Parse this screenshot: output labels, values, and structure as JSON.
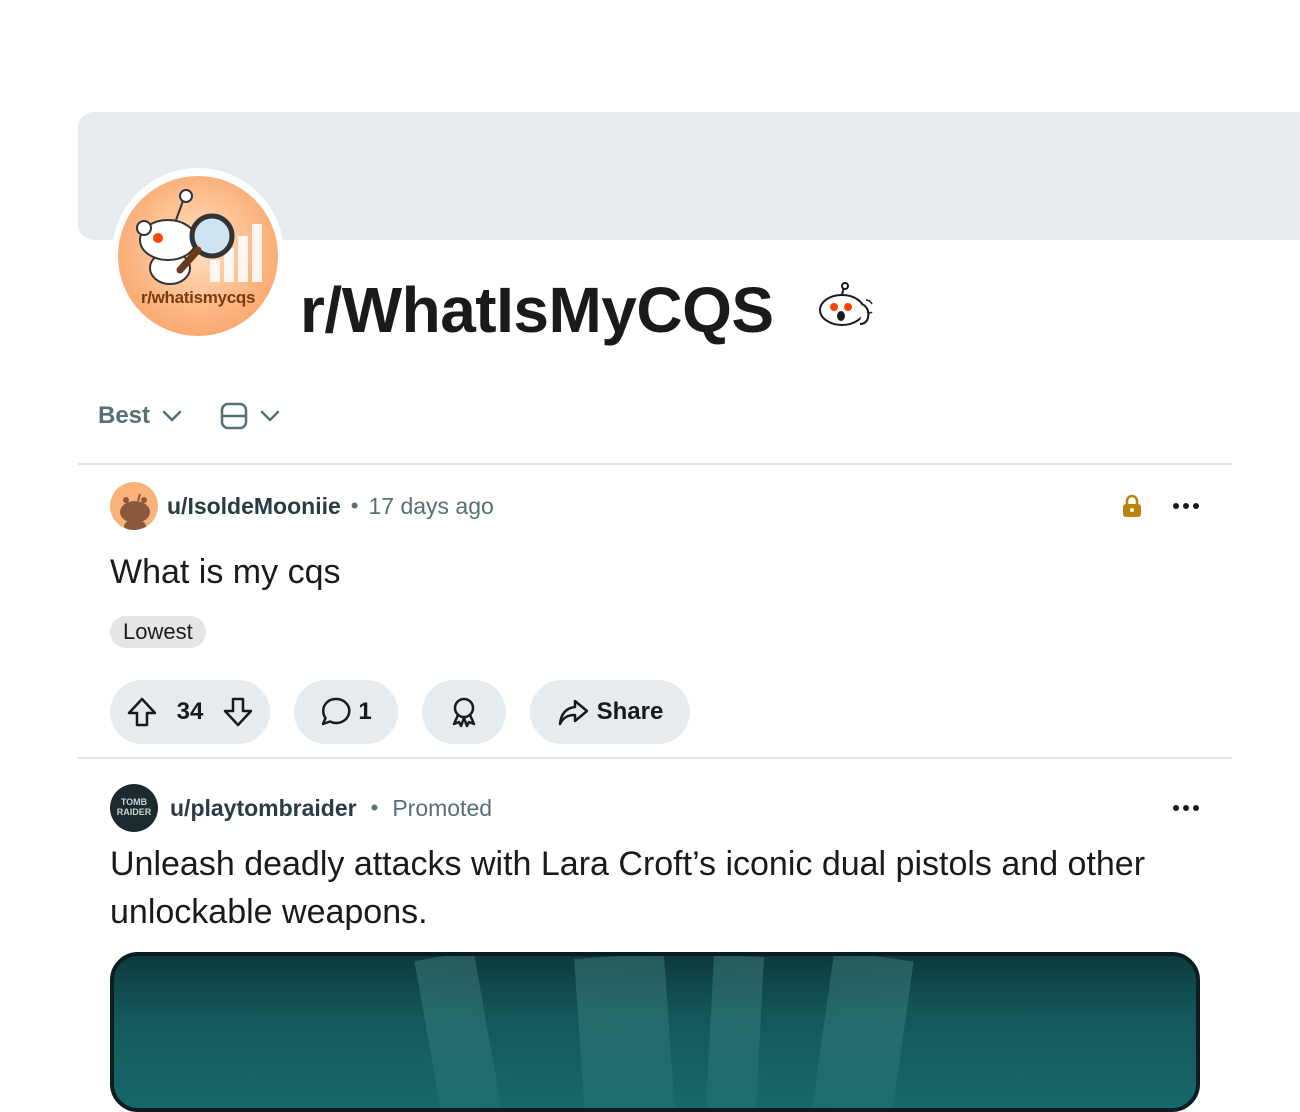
{
  "subreddit": {
    "name": "r/WhatIsMyCQS",
    "avatar_text": "r/whatismycqs",
    "mascot_icon": "snoo-mascot-icon"
  },
  "controls": {
    "sort_label": "Best",
    "view_icon": "card-view-icon"
  },
  "posts": [
    {
      "author": "u/IsoldeMooniie",
      "separator": "•",
      "time": "17 days ago",
      "title": "What is my cqs",
      "flair": "Lowest",
      "locked_icon": "lock-icon",
      "votes": "34",
      "comments": "1",
      "share_label": "Share"
    },
    {
      "author": "u/playtombraider",
      "separator": "•",
      "time": "Promoted",
      "title": "Unleash deadly attacks with Lara Croft’s iconic dual pistols and other unlockable weapons.",
      "avatar_text": "TOMB RAIDER"
    }
  ],
  "colors": {
    "banner": "#e5ebee",
    "pill": "#e5ebee",
    "lock": "#b8860b",
    "muted_text": "#576f76"
  }
}
